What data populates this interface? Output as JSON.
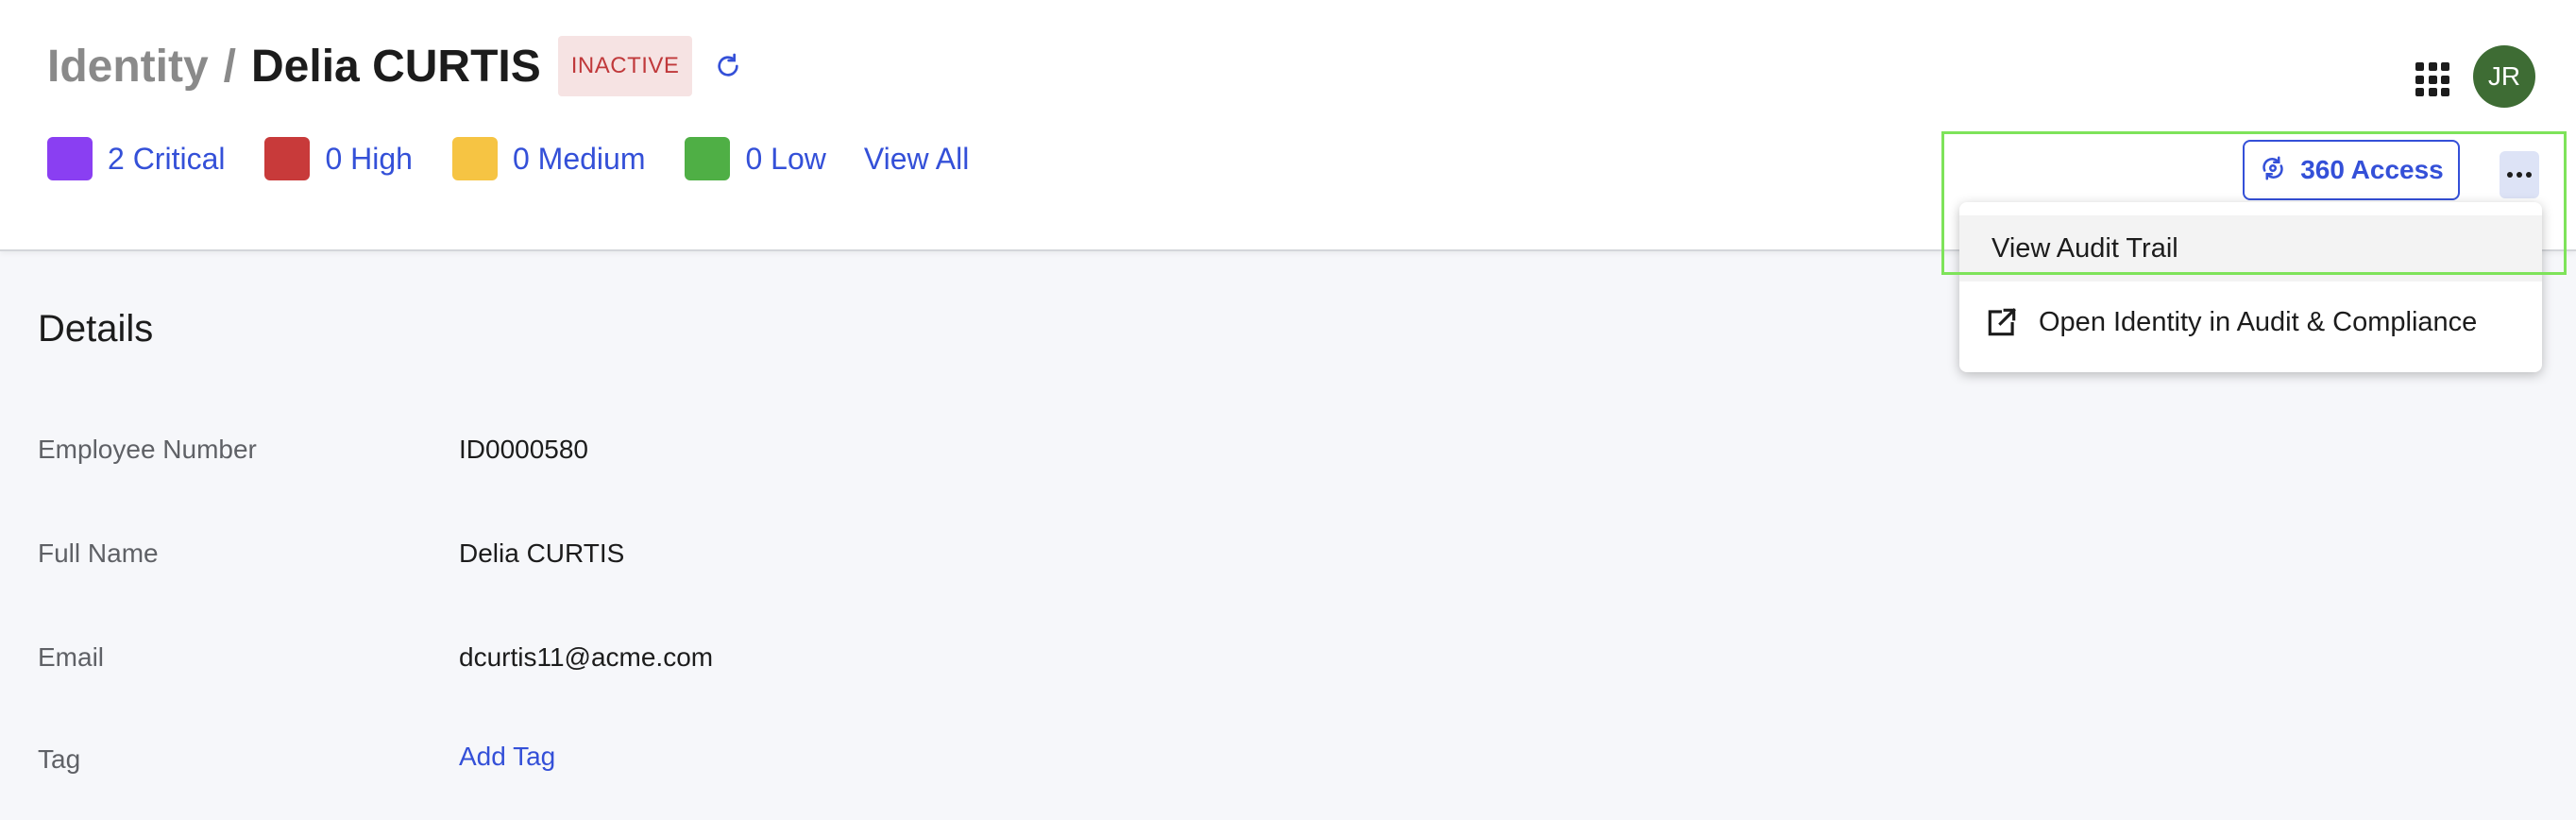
{
  "breadcrumb": {
    "root": "Identity",
    "separator": "/",
    "name": "Delia CURTIS"
  },
  "status": {
    "label": "INACTIVE",
    "color": "#c0393b"
  },
  "risk_summary": {
    "items": [
      {
        "label": "2 Critical",
        "color": "#8a3ff2"
      },
      {
        "label": "0 High",
        "color": "#c83a3a"
      },
      {
        "label": "0 Medium",
        "color": "#f6c443"
      },
      {
        "label": "0 Low",
        "color": "#4faf45"
      }
    ],
    "view_all": "View All"
  },
  "user": {
    "initials": "JR"
  },
  "actions": {
    "access_label": "360 Access"
  },
  "menu": {
    "items": [
      {
        "label": "View Audit Trail"
      },
      {
        "label": "Open Identity in Audit & Compliance"
      }
    ]
  },
  "details": {
    "title": "Details",
    "fields": [
      {
        "label": "Employee Number",
        "value": "ID0000580"
      },
      {
        "label": "Full Name",
        "value": "Delia CURTIS"
      },
      {
        "label": "Email",
        "value": "dcurtis11@acme.com"
      },
      {
        "label": "Tag",
        "value": "Add Tag"
      }
    ]
  },
  "colors": {
    "accent": "#3450d8",
    "avatar": "#3e6c34"
  }
}
